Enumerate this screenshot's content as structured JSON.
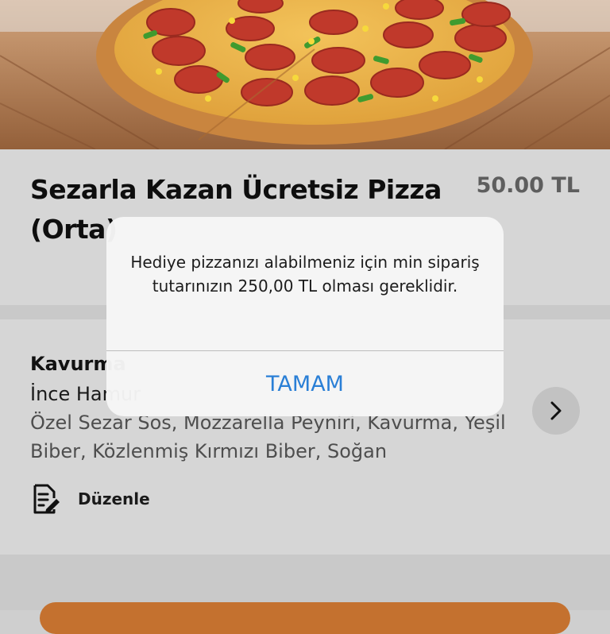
{
  "product": {
    "title": "Sezarla Kazan Ücretsiz Pizza (Orta)",
    "price": "50.00 TL"
  },
  "option": {
    "name": "Kavurma",
    "size": "İnce Hamur",
    "ingredients": "Özel Sezar Sos, Mozzarella Peyniri, Kavurma, Yeşil Biber, Közlenmiş Kırmızı Biber, Soğan",
    "chevron_icon": "chevron-right-icon",
    "edit_icon": "edit-document-icon",
    "edit_label": "Düzenle"
  },
  "alert": {
    "message": "Hediye pizzanızı alabilmeniz için min sipariş tutarınızın 250,00 TL olması gereklidir.",
    "button_label": "TAMAM"
  },
  "colors": {
    "alert_button": "#2a7fd6",
    "primary_button": "#c4712f",
    "price": "#5e5e5e"
  }
}
